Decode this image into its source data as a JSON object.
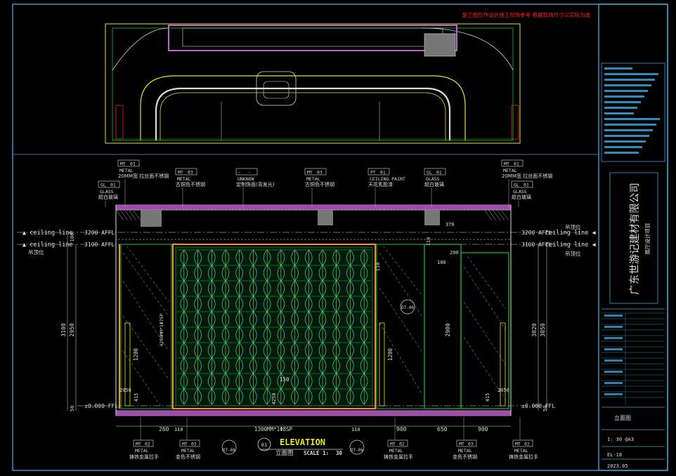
{
  "notice": "施工图仅作设计施工现场参考 根据现场尺寸以实际为准",
  "levels": {
    "ceiling_label": "ceiling line",
    "ceiling_cn": "吊顶位",
    "affl_upper": "3200 AFFL",
    "affl_lower": "3100 AFFL",
    "ffl": "±0.000 FFL"
  },
  "callouts": [
    {
      "code": "MT",
      "num": "01",
      "type": "METAL",
      "desc": "20MM宽 拉丝面不锈钢"
    },
    {
      "code": "GL",
      "num": "01",
      "type": "GLASS",
      "desc": "超白玻璃"
    },
    {
      "code": "MT",
      "num": "03",
      "type": "METAL",
      "desc": "古铜色不锈钢"
    },
    {
      "code": "-",
      "num": "-",
      "type": "UNKNOW",
      "desc": "定制饰面(背发光)"
    },
    {
      "code": "MT",
      "num": "03",
      "type": "METAL",
      "desc": "古铜色不锈钢"
    },
    {
      "code": "PT",
      "num": "01",
      "type": "CEILING PAINT",
      "desc": "天花乳胶漆"
    },
    {
      "code": "GL",
      "num": "01",
      "type": "GLASS",
      "desc": "超白玻璃"
    },
    {
      "code": "MT",
      "num": "01",
      "type": "METAL",
      "desc": "20MM宽 拉丝面不锈钢"
    },
    {
      "code": "GL",
      "num": "01",
      "type": "GLASS",
      "desc": "超白玻璃"
    }
  ],
  "bottom_callouts": [
    {
      "code": "MT",
      "num": "02",
      "type": "METAL",
      "desc": "铸铁金属拉手"
    },
    {
      "code": "MT",
      "num": "03",
      "type": "METAL",
      "desc": "金色不锈钢"
    },
    {
      "code": "MT",
      "num": "02",
      "type": "METAL",
      "desc": "铸铁金属拉手"
    },
    {
      "code": "MT",
      "num": "03",
      "type": "METAL",
      "desc": "金色不锈钢"
    },
    {
      "code": "MT",
      "num": "02",
      "type": "METAL",
      "desc": "铸铁金属拉手"
    }
  ],
  "detail_marks": [
    "DT-06",
    "DT-06",
    "DT-06"
  ],
  "elevation_title": {
    "en": "ELEVATION",
    "cn": "立面图",
    "scale_label": "SCALE 1:",
    "scale": "30",
    "num": "01"
  },
  "dims": {
    "left_total": "3100",
    "left_sub": "2950",
    "left_seg": "1200",
    "left_low": "2050",
    "left_low2": "415",
    "left_base": "50",
    "left_top": "100",
    "door_height": "4250MM*1Φ7SP",
    "panel_label": "4250",
    "center_mark": "150",
    "bottom_panel": "1300MM*1Φ8SP",
    "right_total": "3050",
    "right_sub": "3020",
    "right_door": "2900",
    "right_seg": "1200",
    "right_low": "415",
    "right_low2": "2050",
    "right_base": "50",
    "top_dim": "370",
    "top_dim2": "200",
    "side_dim": "100",
    "side_dim2": "110",
    "side_dim3": "110",
    "bottom": [
      "260",
      "110",
      "110",
      "900",
      "650",
      "900"
    ]
  },
  "title_block": {
    "company": "广东世游记建材有限公司",
    "project": "展厅设计项目",
    "drawing_name": "立面图",
    "scale": "1: 30 @A3",
    "sheet": "EL-18",
    "date": "2023.05"
  },
  "colors": {
    "bg": "#000000",
    "frame": "#3aa3d6",
    "yellow": "#e6e61a",
    "green": "#19c23a",
    "cyan": "#26d4d4",
    "magenta": "#c060c8",
    "white": "#dcdcdc",
    "red": "#ff2020",
    "orange": "#ff8c1a"
  }
}
